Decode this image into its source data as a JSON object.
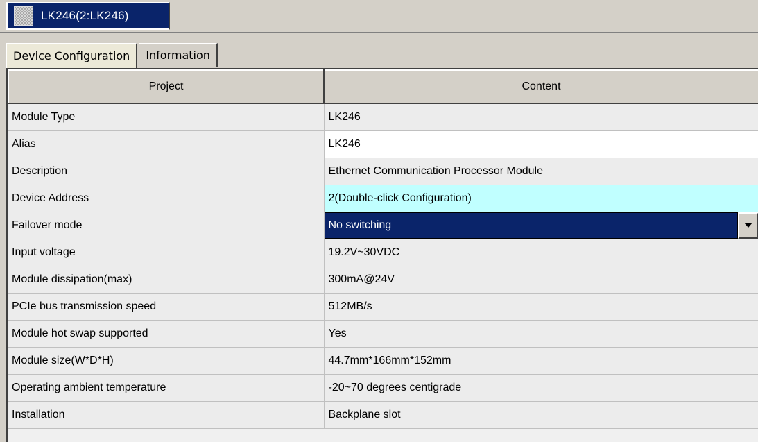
{
  "doc_tab": {
    "title": "LK246(2:LK246)",
    "icon": "grid-icon"
  },
  "tabs": [
    {
      "label": "Device Configuration",
      "active": true
    },
    {
      "label": "Information",
      "active": false
    }
  ],
  "grid": {
    "columns": [
      "Project",
      "Content"
    ],
    "rows": [
      {
        "project": "Module Type",
        "content": "LK246"
      },
      {
        "project": "Alias",
        "content": "LK246"
      },
      {
        "project": "Description",
        "content": "Ethernet Communication Processor Module"
      },
      {
        "project": "Device Address",
        "content": "2(Double-click Configuration)"
      },
      {
        "project": "Failover mode",
        "content": "No switching"
      },
      {
        "project": "Input voltage",
        "content": "19.2V~30VDC"
      },
      {
        "project": "Module dissipation(max)",
        "content": "300mA@24V"
      },
      {
        "project": "PCIe bus transmission speed",
        "content": "512MB/s"
      },
      {
        "project": "Module hot swap supported",
        "content": "Yes"
      },
      {
        "project": "Module size(W*D*H)",
        "content": "44.7mm*166mm*152mm"
      },
      {
        "project": "Operating ambient temperature",
        "content": "-20~70 degrees centigrade"
      },
      {
        "project": "Installation",
        "content": "Backplane slot"
      }
    ]
  },
  "colors": {
    "selection": "#0a246a",
    "editable_cell": "#ffffff",
    "address_cell": "#c0ffff",
    "window_bg": "#d4d0c8"
  }
}
